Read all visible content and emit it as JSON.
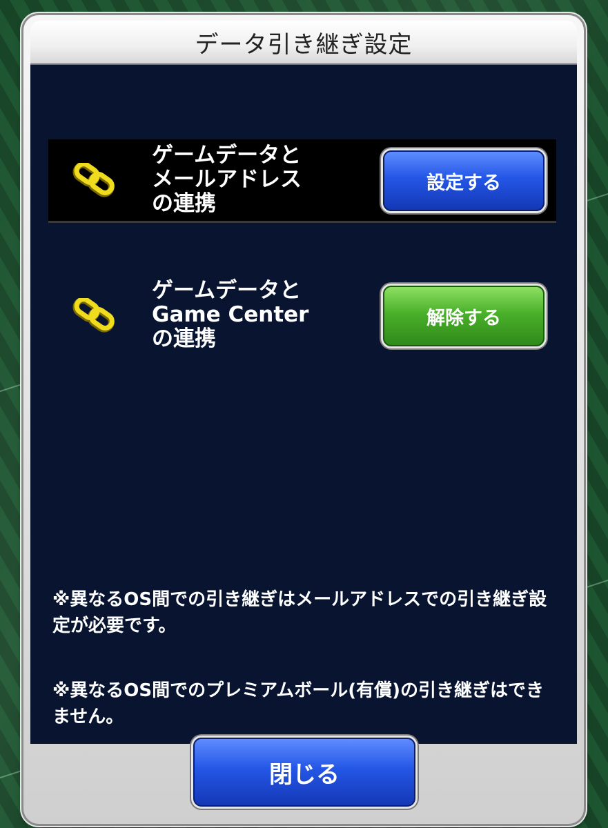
{
  "dialog": {
    "title": "データ引き継ぎ設定"
  },
  "links": [
    {
      "icon": "chain-link-icon",
      "label": "ゲームデータと\nメールアドレス\nの連携",
      "button_label": "設定する",
      "button_color": "#2456e6"
    },
    {
      "icon": "chain-link-icon",
      "label": "ゲームデータと\nGame Center\nの連携",
      "button_label": "解除する",
      "button_color": "#4ab02a"
    }
  ],
  "notes": [
    "※異なるOS間での引き継ぎはメールアドレスでの引き継ぎ設定が必要です。",
    "※異なるOS間でのプレミアムボール(有償)の引き継ぎはできません。"
  ],
  "footer": {
    "close_label": "閉じる"
  },
  "colors": {
    "panel_bg": "#091530",
    "link_icon": "#e8d21a"
  }
}
